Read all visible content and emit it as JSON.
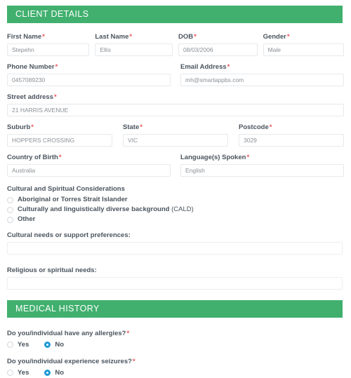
{
  "sections": {
    "client_details": {
      "title": "CLIENT DETAILS",
      "fields": {
        "first_name": {
          "label": "First Name",
          "required": "*",
          "value": "Stepehn"
        },
        "last_name": {
          "label": "Last Name",
          "required": "*",
          "value": "Ellis"
        },
        "dob": {
          "label": "DOB",
          "required": "*",
          "value": "08/03/2006"
        },
        "gender": {
          "label": "Gender",
          "required": "*",
          "value": "Male"
        },
        "phone": {
          "label": "Phone Number",
          "required": "*",
          "value": "0457089230"
        },
        "email": {
          "label": "Email Address",
          "required": "*",
          "value": "mh@smartappbs.com"
        },
        "street": {
          "label": "Street address",
          "required": "*",
          "value": "21 HARRIS AVENUE"
        },
        "suburb": {
          "label": "Suburb",
          "required": "*",
          "value": "HOPPERS CROSSING"
        },
        "state": {
          "label": "State",
          "required": "*",
          "value": "VIC"
        },
        "postcode": {
          "label": "Postcode",
          "required": "*",
          "value": "3029"
        },
        "country_of_birth": {
          "label": "Country of Birth",
          "required": "*",
          "value": "Australia"
        },
        "languages": {
          "label": "Language(s) Spoken",
          "required": "*",
          "value": "English"
        }
      },
      "cultural": {
        "heading": "Cultural and Spiritual Considerations",
        "options": [
          {
            "label": "Aboriginal or Torres Strait Islander",
            "checked": false
          },
          {
            "label": "Culturally and linguistically diverse background ",
            "sub": "(CALD)",
            "checked": false
          },
          {
            "label": "Other",
            "checked": false
          }
        ],
        "needs_label": "Cultural needs or support preferences:",
        "needs_value": "",
        "religious_label": "Religious or spiritual needs:",
        "religious_value": ""
      }
    },
    "medical_history": {
      "title": "MEDICAL HISTORY",
      "questions": [
        {
          "label": "Do you/individual have any allergies?",
          "required": "*",
          "options": [
            {
              "label": "Yes",
              "checked": false
            },
            {
              "label": "No",
              "checked": true
            }
          ]
        },
        {
          "label": "Do you/individual experience seizures?",
          "required": "*",
          "options": [
            {
              "label": "Yes",
              "checked": false
            },
            {
              "label": "No",
              "checked": true
            }
          ]
        }
      ]
    }
  },
  "colors": {
    "header_green": "#41b06e",
    "required_red": "#f2545b",
    "radio_selected_blue": "#1b9ad6",
    "label_text": "#4a545e",
    "value_text": "#8a9096"
  }
}
